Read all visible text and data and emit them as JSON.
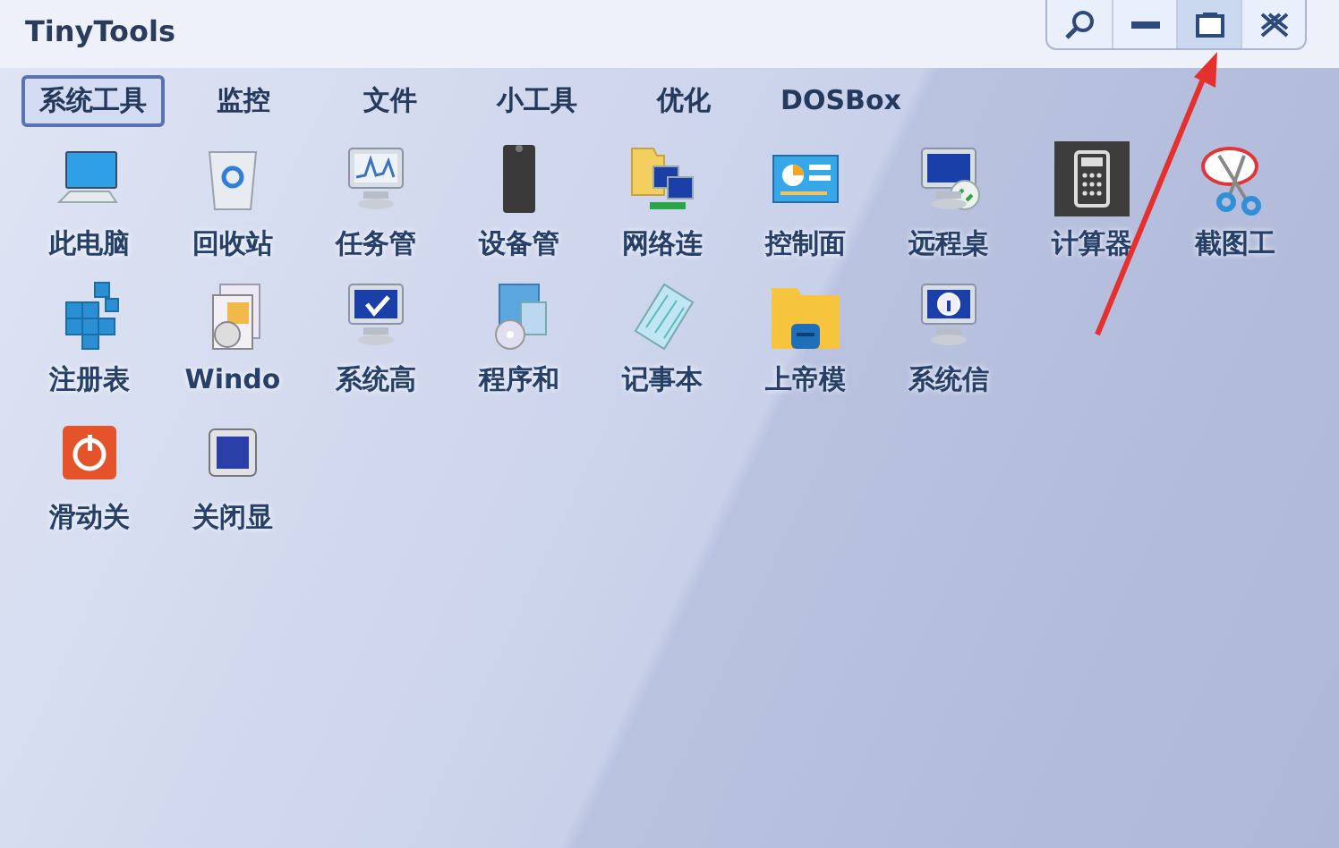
{
  "window": {
    "title": "TinyTools",
    "buttons": [
      {
        "kind": "search",
        "highlighted": false
      },
      {
        "kind": "minimize",
        "highlighted": false
      },
      {
        "kind": "restore",
        "highlighted": true
      },
      {
        "kind": "close",
        "highlighted": false
      }
    ]
  },
  "tabs": [
    {
      "label": "系统工具",
      "selected": true
    },
    {
      "label": "监控",
      "selected": false
    },
    {
      "label": "文件",
      "selected": false
    },
    {
      "label": "小工具",
      "selected": false
    },
    {
      "label": "优化",
      "selected": false
    },
    {
      "label": "DOSBox",
      "selected": false
    }
  ],
  "tool_rows": [
    [
      {
        "label": "此电脑",
        "kind": "monitor"
      },
      {
        "label": "回收站",
        "kind": "bin"
      },
      {
        "label": "任务管",
        "kind": "chart"
      },
      {
        "label": "设备管",
        "kind": "chip"
      },
      {
        "label": "网络连",
        "kind": "network"
      },
      {
        "label": "控制面",
        "kind": "panel"
      },
      {
        "label": "远程桌",
        "kind": "remote"
      },
      {
        "label": "计算器",
        "kind": "calc"
      },
      {
        "label": "截图工",
        "kind": "scissors"
      }
    ],
    [
      {
        "label": "注册表",
        "kind": "cubes"
      },
      {
        "label": "Windo",
        "kind": "media"
      },
      {
        "label": "系统高",
        "kind": "check"
      },
      {
        "label": "程序和",
        "kind": "disc"
      },
      {
        "label": "记事本",
        "kind": "notepad"
      },
      {
        "label": "上帝模",
        "kind": "folder"
      },
      {
        "label": "系统信",
        "kind": "info"
      }
    ],
    [
      {
        "label": "滑动关",
        "kind": "power"
      },
      {
        "label": "关闭显",
        "kind": "moon"
      }
    ]
  ],
  "annotation": {
    "kind": "arrow"
  }
}
